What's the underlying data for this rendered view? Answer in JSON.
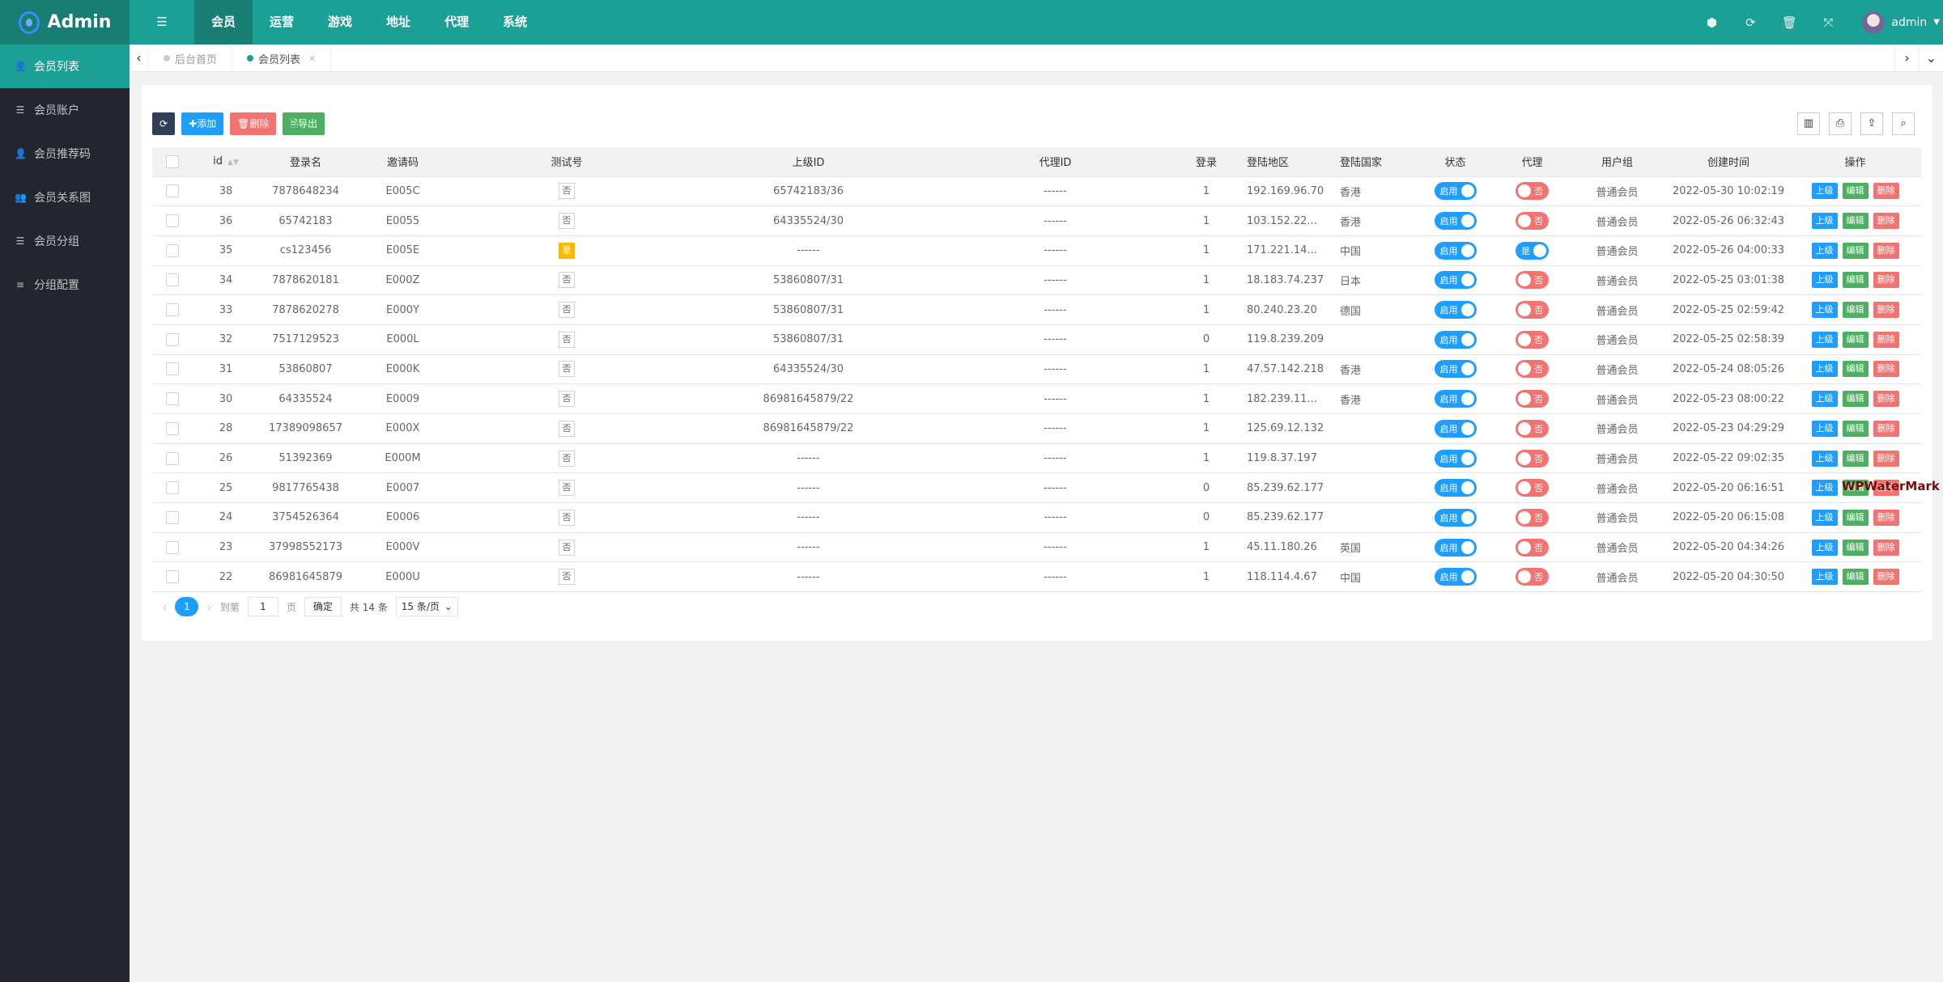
{
  "app": {
    "title": "Admin",
    "user": "admin"
  },
  "colors": {
    "brand": "#1aa094",
    "sidebar": "#23262e",
    "primary": "#1e9fff",
    "danger": "#f27370",
    "success": "#4caf61",
    "warning": "#ffb800"
  },
  "nav": [
    {
      "label": "会员"
    },
    {
      "label": "运营"
    },
    {
      "label": "游戏"
    },
    {
      "label": "地址"
    },
    {
      "label": "代理"
    },
    {
      "label": "系统"
    }
  ],
  "header_icons": [
    "theme-icon",
    "refresh-icon",
    "clear-cache-icon",
    "fullscreen-icon"
  ],
  "sidebar": [
    {
      "label": "会员列表",
      "icon": "user-icon"
    },
    {
      "label": "会员账户",
      "icon": "list-icon"
    },
    {
      "label": "会员推荐码",
      "icon": "user-plus-icon"
    },
    {
      "label": "会员关系图",
      "icon": "users-icon"
    },
    {
      "label": "会员分组",
      "icon": "list-icon"
    },
    {
      "label": "分组配置",
      "icon": "align-icon"
    }
  ],
  "tabs": [
    {
      "label": "后台首页"
    },
    {
      "label": "会员列表"
    }
  ],
  "toolbar": {
    "add": "添加",
    "delete": "删除",
    "export": "导出"
  },
  "columns": [
    "id",
    "登录名",
    "邀请码",
    "测试号",
    "上级ID",
    "代理ID",
    "登录",
    "登陆地区",
    "登陆国家",
    "状态",
    "代理",
    "用户组",
    "创建时间",
    "操作"
  ],
  "actions": {
    "parent": "上级",
    "edit": "编辑",
    "delete": "删除"
  },
  "rows": [
    {
      "id": "38",
      "name": "7878648234",
      "code": "E005C",
      "test": "否",
      "parent": "65742183/36",
      "agent_id": "------",
      "login": "1",
      "ip": "192.169.96.70",
      "country": "香港",
      "status": "启用",
      "agent": "否",
      "group": "普通会员",
      "created": "2022-05-30 10:02:19"
    },
    {
      "id": "36",
      "name": "65742183",
      "code": "E0055",
      "test": "否",
      "parent": "64335524/30",
      "agent_id": "------",
      "login": "1",
      "ip": "103.152.22...",
      "country": "香港",
      "status": "启用",
      "agent": "否",
      "group": "普通会员",
      "created": "2022-05-26 06:32:43"
    },
    {
      "id": "35",
      "name": "cs123456",
      "code": "E005E",
      "test": "是",
      "parent": "------",
      "agent_id": "------",
      "login": "1",
      "ip": "171.221.14...",
      "country": "中国",
      "status": "启用",
      "agent": "是",
      "group": "普通会员",
      "created": "2022-05-26 04:00:33"
    },
    {
      "id": "34",
      "name": "7878620181",
      "code": "E000Z",
      "test": "否",
      "parent": "53860807/31",
      "agent_id": "------",
      "login": "1",
      "ip": "18.183.74.237",
      "country": "日本",
      "status": "启用",
      "agent": "否",
      "group": "普通会员",
      "created": "2022-05-25 03:01:38"
    },
    {
      "id": "33",
      "name": "7878620278",
      "code": "E000Y",
      "test": "否",
      "parent": "53860807/31",
      "agent_id": "------",
      "login": "1",
      "ip": "80.240.23.20",
      "country": "德国",
      "status": "启用",
      "agent": "否",
      "group": "普通会员",
      "created": "2022-05-25 02:59:42"
    },
    {
      "id": "32",
      "name": "7517129523",
      "code": "E000L",
      "test": "否",
      "parent": "53860807/31",
      "agent_id": "------",
      "login": "0",
      "ip": "119.8.239.209",
      "country": "",
      "status": "启用",
      "agent": "否",
      "group": "普通会员",
      "created": "2022-05-25 02:58:39"
    },
    {
      "id": "31",
      "name": "53860807",
      "code": "E000K",
      "test": "否",
      "parent": "64335524/30",
      "agent_id": "------",
      "login": "1",
      "ip": "47.57.142.218",
      "country": "香港",
      "status": "启用",
      "agent": "否",
      "group": "普通会员",
      "created": "2022-05-24 08:05:26"
    },
    {
      "id": "30",
      "name": "64335524",
      "code": "E0009",
      "test": "否",
      "parent": "86981645879/22",
      "agent_id": "------",
      "login": "1",
      "ip": "182.239.11...",
      "country": "香港",
      "status": "启用",
      "agent": "否",
      "group": "普通会员",
      "created": "2022-05-23 08:00:22"
    },
    {
      "id": "28",
      "name": "17389098657",
      "code": "E000X",
      "test": "否",
      "parent": "86981645879/22",
      "agent_id": "------",
      "login": "1",
      "ip": "125.69.12.132",
      "country": "",
      "status": "启用",
      "agent": "否",
      "group": "普通会员",
      "created": "2022-05-23 04:29:29"
    },
    {
      "id": "26",
      "name": "51392369",
      "code": "E000M",
      "test": "否",
      "parent": "------",
      "agent_id": "------",
      "login": "1",
      "ip": "119.8.37.197",
      "country": "",
      "status": "启用",
      "agent": "否",
      "group": "普通会员",
      "created": "2022-05-22 09:02:35"
    },
    {
      "id": "25",
      "name": "9817765438",
      "code": "E0007",
      "test": "否",
      "parent": "------",
      "agent_id": "------",
      "login": "0",
      "ip": "85.239.62.177",
      "country": "",
      "status": "启用",
      "agent": "否",
      "group": "普通会员",
      "created": "2022-05-20 06:16:51"
    },
    {
      "id": "24",
      "name": "3754526364",
      "code": "E0006",
      "test": "否",
      "parent": "------",
      "agent_id": "------",
      "login": "0",
      "ip": "85.239.62.177",
      "country": "",
      "status": "启用",
      "agent": "否",
      "group": "普通会员",
      "created": "2022-05-20 06:15:08"
    },
    {
      "id": "23",
      "name": "37998552173",
      "code": "E000V",
      "test": "否",
      "parent": "------",
      "agent_id": "------",
      "login": "1",
      "ip": "45.11.180.26",
      "country": "英国",
      "status": "启用",
      "agent": "否",
      "group": "普通会员",
      "created": "2022-05-20 04:34:26"
    },
    {
      "id": "22",
      "name": "86981645879",
      "code": "E000U",
      "test": "否",
      "parent": "------",
      "agent_id": "------",
      "login": "1",
      "ip": "118.114.4.67",
      "country": "中国",
      "status": "启用",
      "agent": "否",
      "group": "普通会员",
      "created": "2022-05-20 04:30:50"
    }
  ],
  "pager": {
    "current": "1",
    "goto_label": "到第",
    "goto_value": "1",
    "page_unit": "页",
    "confirm": "确定",
    "total": "共 14 条",
    "page_size": "15 条/页"
  },
  "watermark": "WPWaterMark"
}
